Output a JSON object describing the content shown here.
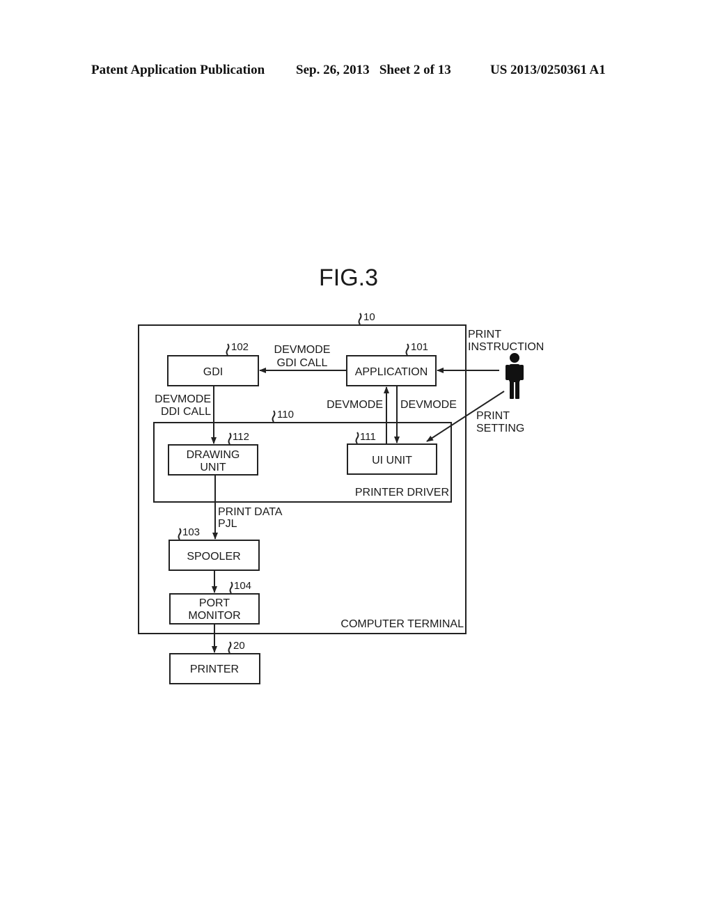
{
  "header": {
    "publication": "Patent Application Publication",
    "date_sheet": "Sep. 26, 2013   Sheet 2 of 13",
    "number": "US 2013/0250361 A1"
  },
  "figure": {
    "title": "FIG.3",
    "nodes": {
      "computer_terminal": {
        "ref": "10",
        "label": "COMPUTER TERMINAL"
      },
      "gdi": {
        "ref": "102",
        "label": "GDI"
      },
      "application": {
        "ref": "101",
        "label": "APPLICATION"
      },
      "printer_driver": {
        "ref": "110",
        "label": "PRINTER DRIVER"
      },
      "drawing_unit": {
        "ref": "112",
        "label_line1": "DRAWING",
        "label_line2": "UNIT"
      },
      "ui_unit": {
        "ref": "111",
        "label": "UI UNIT"
      },
      "spooler": {
        "ref": "103",
        "label": "SPOOLER"
      },
      "port_monitor": {
        "ref": "104",
        "label_line1": "PORT",
        "label_line2": "MONITOR"
      },
      "printer": {
        "ref": "20",
        "label": "PRINTER"
      }
    },
    "edges": {
      "app_to_gdi_line1": "DEVMODE",
      "app_to_gdi_line2": "GDI CALL",
      "gdi_to_drawing_line1": "DEVMODE",
      "gdi_to_drawing_line2": "DDI CALL",
      "ui_to_app": "DEVMODE",
      "app_to_ui": "DEVMODE",
      "drawing_to_spooler_line1": "PRINT DATA",
      "drawing_to_spooler_line2": "PJL",
      "user_to_app_line1": "PRINT",
      "user_to_app_line2": "INSTRUCTION",
      "user_to_ui_line1": "PRINT",
      "user_to_ui_line2": "SETTING"
    },
    "actor": {
      "icon": "person-icon"
    }
  }
}
